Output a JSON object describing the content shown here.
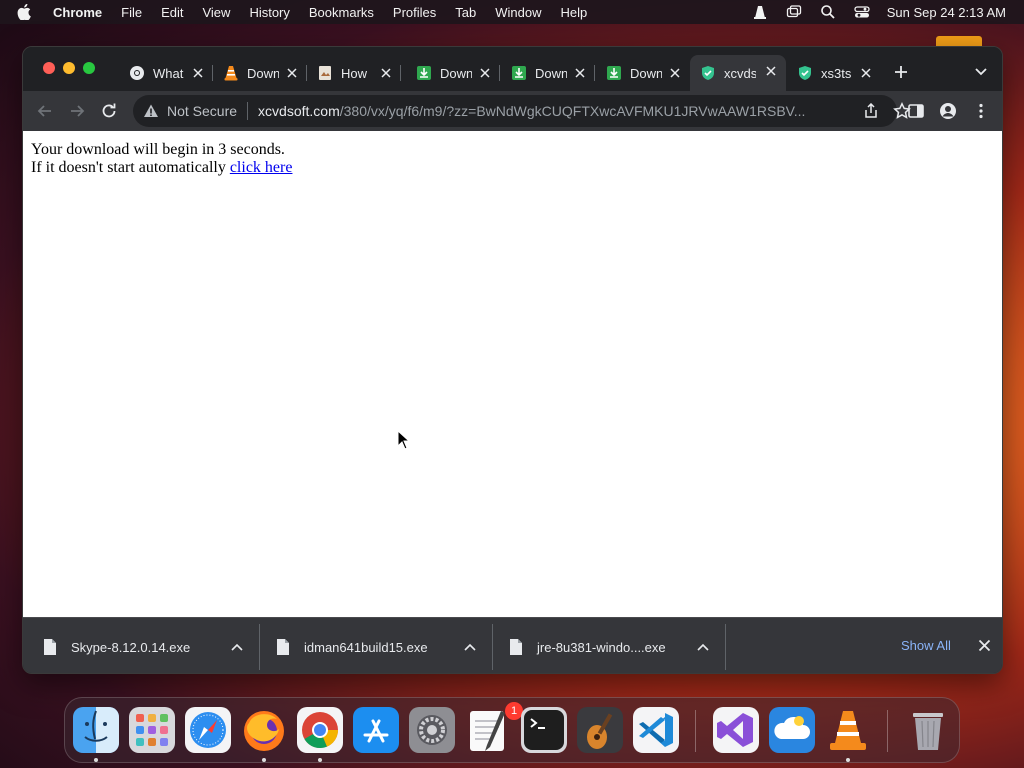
{
  "menubar": {
    "app_name": "Chrome",
    "items": [
      "File",
      "Edit",
      "View",
      "History",
      "Bookmarks",
      "Profiles",
      "Tab",
      "Window",
      "Help"
    ],
    "clock": "Sun Sep 24  2:13 AM"
  },
  "browser": {
    "tabs": [
      {
        "title": "What",
        "icon": "chrome-icon"
      },
      {
        "title": "Down",
        "icon": "vlc-cone-icon"
      },
      {
        "title": "How",
        "icon": "document-icon"
      },
      {
        "title": "Down",
        "icon": "green-download-icon"
      },
      {
        "title": "Down",
        "icon": "green-download-icon"
      },
      {
        "title": "Down",
        "icon": "green-download-icon"
      },
      {
        "title": "xcvds",
        "icon": "shield-icon",
        "active": true
      },
      {
        "title": "xs3ts",
        "icon": "shield-icon"
      }
    ],
    "omnibox": {
      "security_label": "Not Secure",
      "url_host": "xcvdsoft.com",
      "url_path": "/380/vx/yq/f6/m9/?zz=BwNdWgkCUQFTXwcAVFMKU1JRVwAAW1RSBV..."
    }
  },
  "page": {
    "line1": "Your download will begin in 3 seconds.",
    "line2_text": "If it doesn't start automatically ",
    "line2_link": "click here"
  },
  "downloads": {
    "items": [
      {
        "filename": "Skype-8.12.0.14.exe"
      },
      {
        "filename": "idman641build15.exe"
      },
      {
        "filename": "jre-8u381-windo....exe"
      }
    ],
    "show_all_label": "Show All"
  },
  "dock": {
    "apps": [
      "finder-icon",
      "launchpad-icon",
      "safari-icon",
      "firefox-icon",
      "chrome-icon",
      "app-store-icon",
      "system-settings-icon",
      "textedit-icon",
      "terminal-icon",
      "garageband-icon",
      "vscode-icon",
      "visual-studio-icon",
      "cloud-app-icon",
      "vlc-icon",
      "trash-icon"
    ],
    "settings_badge": "1"
  },
  "colors": {
    "accent": "#8ab4f8",
    "link": "#0000ee"
  }
}
